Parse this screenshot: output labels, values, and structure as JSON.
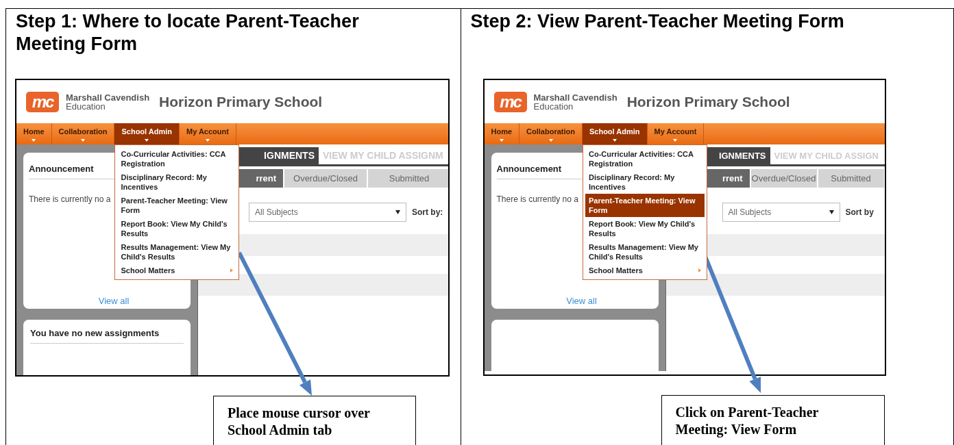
{
  "steps": [
    {
      "title": "Step 1: Where to locate Parent-Teacher Meeting Form",
      "app": {
        "logo_mark": "mc",
        "brand": "Marshall Cavendish",
        "brand_sub": "Education",
        "school": "Horizon Primary School",
        "nav": [
          {
            "label": "Home",
            "selected": false
          },
          {
            "label": "Collaboration",
            "selected": false
          },
          {
            "label": "School Admin",
            "selected": true
          },
          {
            "label": "My Account",
            "selected": false
          }
        ],
        "menu": [
          {
            "label": "Co-Curricular Activities: CCA Registration",
            "selected": false,
            "submenu": false
          },
          {
            "label": "Disciplinary Record: My Incentives",
            "selected": false,
            "submenu": false
          },
          {
            "label": "Parent-Teacher Meeting: View Form",
            "selected": false,
            "submenu": false
          },
          {
            "label": "Report Book: View My Child's Results",
            "selected": false,
            "submenu": false
          },
          {
            "label": "Results Management: View My Child's Results",
            "selected": false,
            "submenu": false
          },
          {
            "label": "School Matters",
            "selected": false,
            "submenu": true
          }
        ],
        "announcement": {
          "title": "Announcement",
          "message": "There is currently no a",
          "link": "View all"
        },
        "second_card": {
          "title": "You have no new assignments"
        },
        "tabs": [
          {
            "label": "IGNMENTS",
            "selected": true
          },
          {
            "label": "VIEW MY CHILD ASSIGNM",
            "selected": false
          }
        ],
        "subtabs": [
          {
            "label": "rrent",
            "selected": true
          },
          {
            "label": "Overdue/Closed",
            "selected": false
          },
          {
            "label": "Submitted",
            "selected": false
          }
        ],
        "subject_select": "All Subjects",
        "sort_label": "Sort by:"
      },
      "callout": "Place mouse cursor over School Admin tab"
    },
    {
      "title": "Step 2: View Parent-Teacher Meeting Form",
      "app": {
        "logo_mark": "mc",
        "brand": "Marshall Cavendish",
        "brand_sub": "Education",
        "school": "Horizon Primary School",
        "nav": [
          {
            "label": "Home",
            "selected": false
          },
          {
            "label": "Collaboration",
            "selected": false
          },
          {
            "label": "School Admin",
            "selected": true
          },
          {
            "label": "My Account",
            "selected": false
          }
        ],
        "menu": [
          {
            "label": "Co-Curricular Activities: CCA Registration",
            "selected": false,
            "submenu": false
          },
          {
            "label": "Disciplinary Record: My Incentives",
            "selected": false,
            "submenu": false
          },
          {
            "label": "Parent-Teacher Meeting: View Form",
            "selected": true,
            "submenu": false
          },
          {
            "label": "Report Book: View My Child's Results",
            "selected": false,
            "submenu": false
          },
          {
            "label": "Results Management: View My Child's Results",
            "selected": false,
            "submenu": false
          },
          {
            "label": "School Matters",
            "selected": false,
            "submenu": true
          }
        ],
        "announcement": {
          "title": "Announcement",
          "message": "There is currently no a",
          "link": "View all"
        },
        "tabs": [
          {
            "label": "IGNMENTS",
            "selected": true
          },
          {
            "label": "VIEW MY CHILD ASSIGN",
            "selected": false
          }
        ],
        "subtabs": [
          {
            "label": "rrent",
            "selected": true
          },
          {
            "label": "Overdue/Closed",
            "selected": false
          },
          {
            "label": "Submitted",
            "selected": false
          }
        ],
        "subject_select": "All Subjects",
        "sort_label": "Sort by"
      },
      "callout": "Click on Parent-Teacher Meeting: View Form"
    }
  ]
}
